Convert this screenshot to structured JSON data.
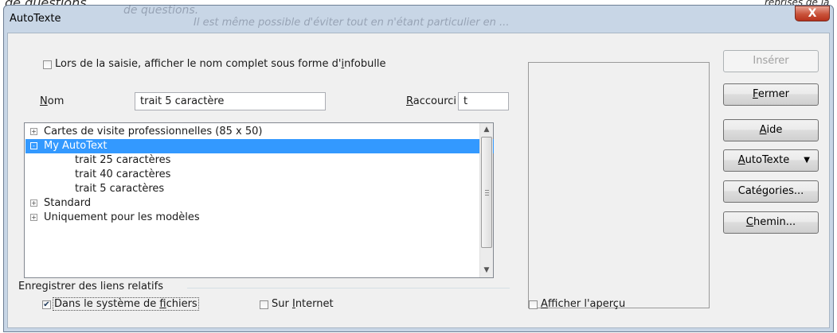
{
  "background": {
    "top_text_1": "de questions.",
    "top_text_2": "Il est même possible d'éviter tout en n'étant particulier en ...",
    "top_right_text": "reprises de la"
  },
  "window": {
    "title": "AutoTexte",
    "close_glyph": "X"
  },
  "options": {
    "tooltip_checkbox_label_pre": "Lors de la saisie, afficher le nom complet sous forme d'",
    "tooltip_checkbox_label_u": "i",
    "tooltip_checkbox_label_post": "nfobulle",
    "tooltip_checked": false
  },
  "name_field": {
    "label_u": "N",
    "label_rest": "om",
    "value": "trait 5 caractère"
  },
  "shortcut_field": {
    "label_u": "R",
    "label_rest": "accourci",
    "value": "t"
  },
  "tree": {
    "items": [
      {
        "label": "Cartes de visite professionnelles (85 x 50)",
        "expander": "+"
      },
      {
        "label": "My AutoText",
        "expander": "-"
      },
      {
        "label": "trait 25 caractères"
      },
      {
        "label": "trait 40 caractères"
      },
      {
        "label": "trait 5 caractères"
      },
      {
        "label": "Standard",
        "expander": "+"
      },
      {
        "label": "Uniquement pour les modèles",
        "expander": "+"
      }
    ],
    "selected_index": 1
  },
  "relative_links": {
    "group_label": "Enregistrer des liens relatifs",
    "filesystem_pre": "Dans le système de ",
    "filesystem_u": "f",
    "filesystem_post": "ichiers",
    "filesystem_checked": true,
    "internet_pre": "Sur ",
    "internet_u": "I",
    "internet_post": "nternet",
    "internet_checked": false
  },
  "preview": {
    "show_preview_u": "A",
    "show_preview_rest": "fficher l'aperçu",
    "show_preview_checked": false
  },
  "buttons": {
    "insert": "Insérer",
    "close_u": "F",
    "close_rest": "ermer",
    "help_u": "A",
    "help_rest": "ide",
    "autotext_u": "A",
    "autotext_rest": "utoTexte",
    "autotext_caret": "▼",
    "categories": "Catégories...",
    "path_u": "C",
    "path_rest": "hemin..."
  },
  "colors": {
    "selection": "#3399ff",
    "window_frame": "#c8d6e6",
    "close_button": "#c9533a"
  }
}
